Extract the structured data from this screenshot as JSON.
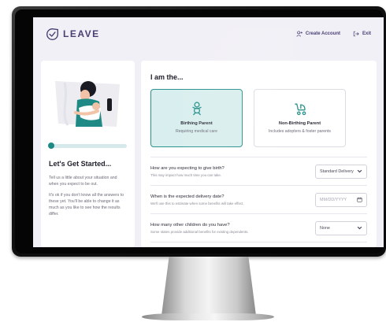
{
  "brand": {
    "name": "LEAVE",
    "accent": "#4a3f73",
    "teal": "#2a938c"
  },
  "header": {
    "create_account": "Create Account",
    "exit": "Exit"
  },
  "sidebar": {
    "progress_fraction": 0.05,
    "title": "Let's Get Started...",
    "paragraph1": "Tell us a little about your situation and when you expect to be out.",
    "paragraph2": "It's ok if you don't know all the answers to these yet. You'll be able to change it as much as you like to see how the results differ."
  },
  "main": {
    "title": "I am the...",
    "options": [
      {
        "label": "Birthing Parent",
        "sub": "Requiring medical care",
        "icon": "baby-icon",
        "selected": true
      },
      {
        "label": "Non-Birthing Parent",
        "sub": "Includes adopters & foster parents",
        "icon": "stroller-icon",
        "selected": false
      }
    ],
    "questions": [
      {
        "title": "How are you expecting to give birth?",
        "hint": "This may impact how much time you can take.",
        "value": "Standard Delivery",
        "control": "select"
      },
      {
        "title": "When is the expected delivery date?",
        "hint": "We'll use this to estimate when some benefits will take effect.",
        "placeholder": "MM/DD/YYYY",
        "control": "date"
      },
      {
        "title": "How many other children do you have?",
        "hint": "Some states provide additional benefits for existing dependents.",
        "value": "None",
        "control": "select"
      }
    ]
  }
}
